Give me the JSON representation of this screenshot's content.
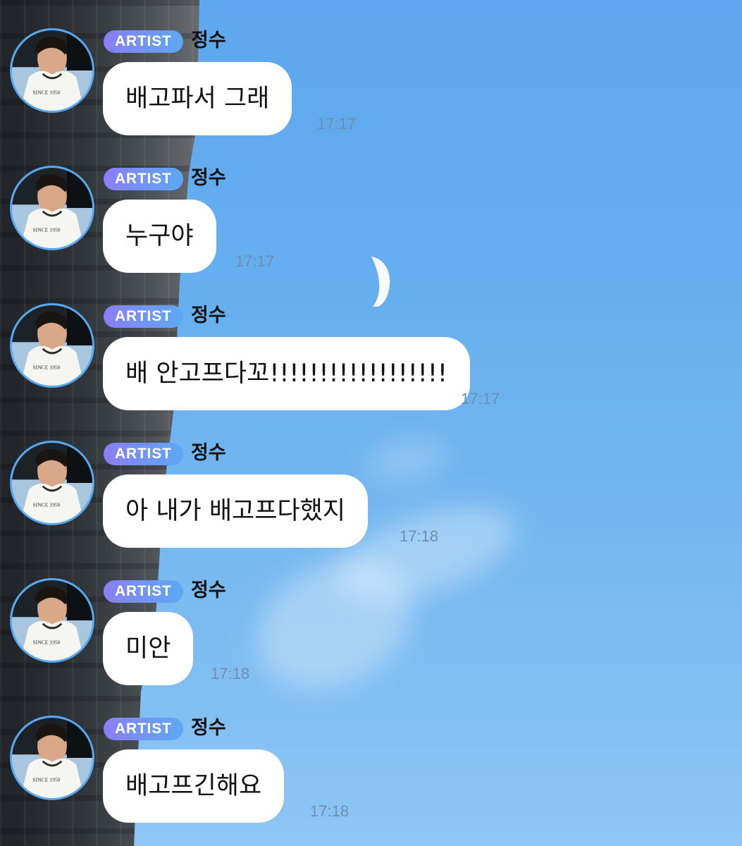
{
  "chat": {
    "messages": [
      {
        "badge": "ARTIST",
        "sender": "정수",
        "text": "배고파서 그래",
        "time": "17:17"
      },
      {
        "badge": "ARTIST",
        "sender": "정수",
        "text": "누구야",
        "time": "17:17"
      },
      {
        "badge": "ARTIST",
        "sender": "정수",
        "text": "배 안고프다꼬!!!!!!!!!!!!!!!!!!",
        "time": "17:17"
      },
      {
        "badge": "ARTIST",
        "sender": "정수",
        "text": "아 내가 배고프다했지",
        "time": "17:18"
      },
      {
        "badge": "ARTIST",
        "sender": "정수",
        "text": "미안",
        "time": "17:18"
      },
      {
        "badge": "ARTIST",
        "sender": "정수",
        "text": "배고프긴해요",
        "time": "17:18"
      }
    ]
  },
  "avatar_icon": "profile-photo-icon",
  "colors": {
    "badge_start": "#8a7ef5",
    "badge_end": "#5ca9f2",
    "bubble": "#ffffff",
    "timestamp": "#6b8fb1",
    "avatar_ring": "#56a8f2"
  }
}
